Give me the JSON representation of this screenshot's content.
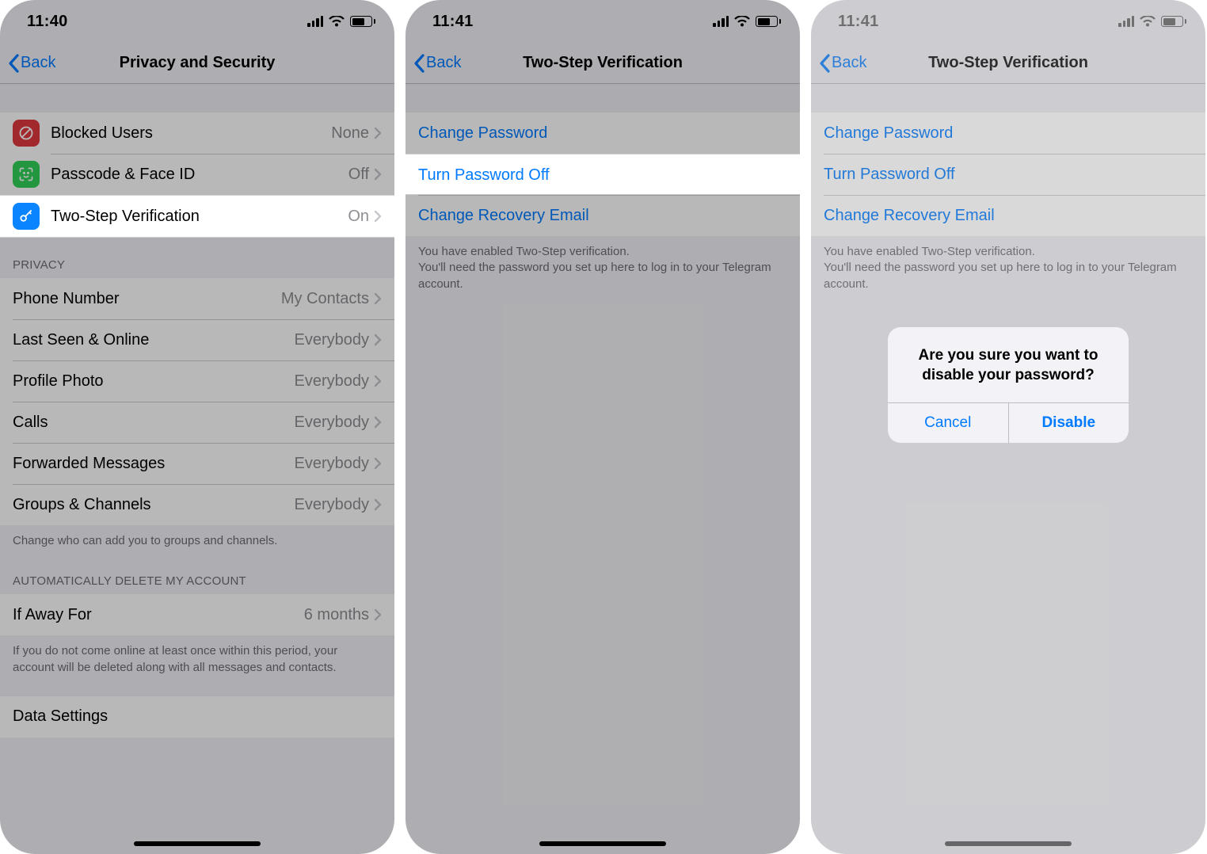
{
  "colors": {
    "accent": "#007aff"
  },
  "screen1": {
    "time": "11:40",
    "back_label": "Back",
    "title": "Privacy and Security",
    "security_rows": [
      {
        "icon": "ban",
        "name": "blocked-users",
        "label": "Blocked Users",
        "value": "None"
      },
      {
        "icon": "faceid",
        "name": "passcode-faceid",
        "label": "Passcode & Face ID",
        "value": "Off"
      },
      {
        "icon": "key",
        "name": "two-step-verification",
        "label": "Two-Step Verification",
        "value": "On"
      }
    ],
    "privacy_header": "PRIVACY",
    "privacy_rows": [
      {
        "name": "phone-number",
        "label": "Phone Number",
        "value": "My Contacts"
      },
      {
        "name": "last-seen",
        "label": "Last Seen & Online",
        "value": "Everybody"
      },
      {
        "name": "profile-photo",
        "label": "Profile Photo",
        "value": "Everybody"
      },
      {
        "name": "calls",
        "label": "Calls",
        "value": "Everybody"
      },
      {
        "name": "forwarded",
        "label": "Forwarded Messages",
        "value": "Everybody"
      },
      {
        "name": "groups",
        "label": "Groups & Channels",
        "value": "Everybody"
      }
    ],
    "privacy_footer": "Change who can add you to groups and channels.",
    "auto_delete_header": "AUTOMATICALLY DELETE MY ACCOUNT",
    "auto_delete_row": {
      "label": "If Away For",
      "value": "6 months"
    },
    "auto_delete_footer": "If you do not come online at least once within this period, your account will be deleted along with all messages and contacts.",
    "data_settings_label": "Data Settings"
  },
  "screen2": {
    "time": "11:41",
    "back_label": "Back",
    "title": "Two-Step Verification",
    "rows": {
      "change_password": "Change Password",
      "turn_off": "Turn Password Off",
      "change_email": "Change Recovery Email"
    },
    "footer": "You have enabled Two-Step verification.\nYou'll need the password you set up here to log in to your Telegram account."
  },
  "screen3": {
    "time": "11:41",
    "back_label": "Back",
    "title": "Two-Step Verification",
    "rows": {
      "change_password": "Change Password",
      "turn_off": "Turn Password Off",
      "change_email": "Change Recovery Email"
    },
    "footer": "You have enabled Two-Step verification.\nYou'll need the password you set up here to log in to your Telegram account.",
    "alert": {
      "message": "Are you sure you want to disable your password?",
      "cancel": "Cancel",
      "disable": "Disable"
    }
  }
}
